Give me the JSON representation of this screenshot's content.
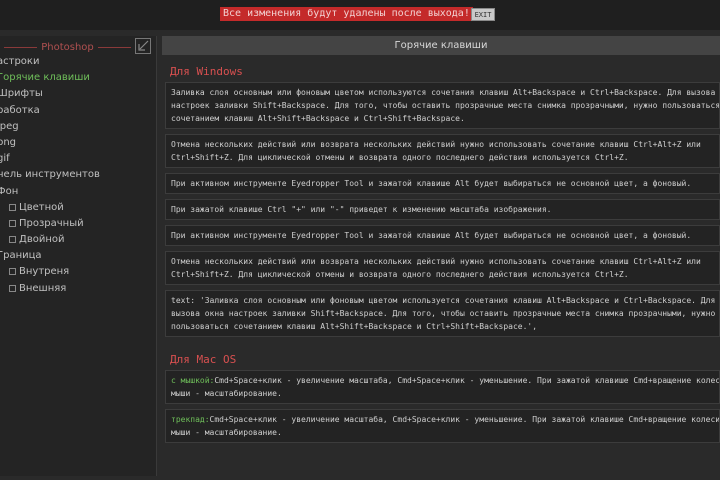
{
  "topbar": {
    "warning": "Все изменения будут удалены после выхода!",
    "exit_label": "EXIT"
  },
  "sidebar": {
    "title": "Photoshop",
    "collapse_icon": "collapse-arrow-icon",
    "items": [
      {
        "label": "астроки",
        "level": 0
      },
      {
        "label": "Горячие клавиши",
        "level": 0,
        "active": true
      },
      {
        "label": "Шрифты",
        "level": 0
      },
      {
        "label": "работка",
        "level": 0
      },
      {
        "label": "jpeg",
        "level": 0
      },
      {
        "label": "png",
        "level": 0
      },
      {
        "label": "gif",
        "level": 0
      },
      {
        "label": "нель инструментов",
        "level": 0
      },
      {
        "label": "Фон",
        "level": 0
      },
      {
        "label": "Цветной",
        "level": 2
      },
      {
        "label": "Прозрачный",
        "level": 2
      },
      {
        "label": "Двойной",
        "level": 2
      },
      {
        "label": "Граница",
        "level": 0
      },
      {
        "label": "Внутреня",
        "level": 2
      },
      {
        "label": "Внешняя",
        "level": 2
      }
    ]
  },
  "main": {
    "header": "Горячие клавиши",
    "windows_title": "Для Windows",
    "windows_cards": [
      {
        "lines": [
          "Заливка слоя основным или фоновым цветом используются сочетания клавиш Alt+Backspace и Ctrl+Backspace. Для вызова окна",
          "настроек заливки Shift+Backspace. Для того, чтобы оставить прозрачные места снимка прозрачными, нужно пользоваться",
          "сочетанием клавиш Alt+Shift+Backspace и Ctrl+Shift+Backspace."
        ]
      },
      {
        "lines": [
          "Отмена нескольких действий или возврата нескольких действий нужно использовать сочетание клавиш Ctrl+Alt+Z или",
          "Ctrl+Shift+Z. Для циклической отмены и возврата одного последнего действия используется Ctrl+Z."
        ]
      },
      {
        "lines": [
          "При активном инструменте Eyedropper Tool и зажатой клавише Alt будет выбираться не основной цвет, а фоновый."
        ]
      },
      {
        "lines": [
          "При зажатой клавише Ctrl \"+\" или \"-\" приведет к изменению масштаба изображения."
        ]
      },
      {
        "lines": [
          "При активном инструменте Eyedropper Tool и зажатой клавише Alt будет выбираться не основной цвет, а фоновый."
        ]
      },
      {
        "lines": [
          "Отмена нескольких действий или возврата нескольких действий нужно использовать сочетание клавиш Ctrl+Alt+Z или",
          "Ctrl+Shift+Z. Для циклической отмены и возврата одного последнего действия используется Ctrl+Z."
        ]
      },
      {
        "lines": [
          "text: 'Заливка слоя основным или фоновым цветом используется сочетания клавиш Alt+Backspace и Ctrl+Backspace. Для",
          "вызова окна настроек заливки Shift+Backspace. Для того, чтобы оставить прозрачные места снимка прозрачными, нужно",
          "пользоваться сочетанием клавиш Alt+Shift+Backspace и Ctrl+Shift+Backspace.',"
        ]
      }
    ],
    "mac_title": "Для Mac OS",
    "mac_cards": [
      {
        "prefix": "с мышкой:",
        "lines": [
          "Cmd+Space+клик - увеличение масштаба, Cmd+Space+клик - уменьшение. При зажатой клавише Cmd+вращение колесика",
          "мыши - масштабирование."
        ]
      },
      {
        "prefix": "трекпад:",
        "lines": [
          "Cmd+Space+клик - увеличение масштаба, Cmd+Space+клик - уменьшение. При зажатой клавише Cmd+вращение колесика",
          "мыши - масштабирование."
        ]
      }
    ]
  },
  "colors": {
    "accent_red": "#d85050",
    "active_green": "#6fbf5a",
    "warning_bg": "#c42a2a"
  }
}
